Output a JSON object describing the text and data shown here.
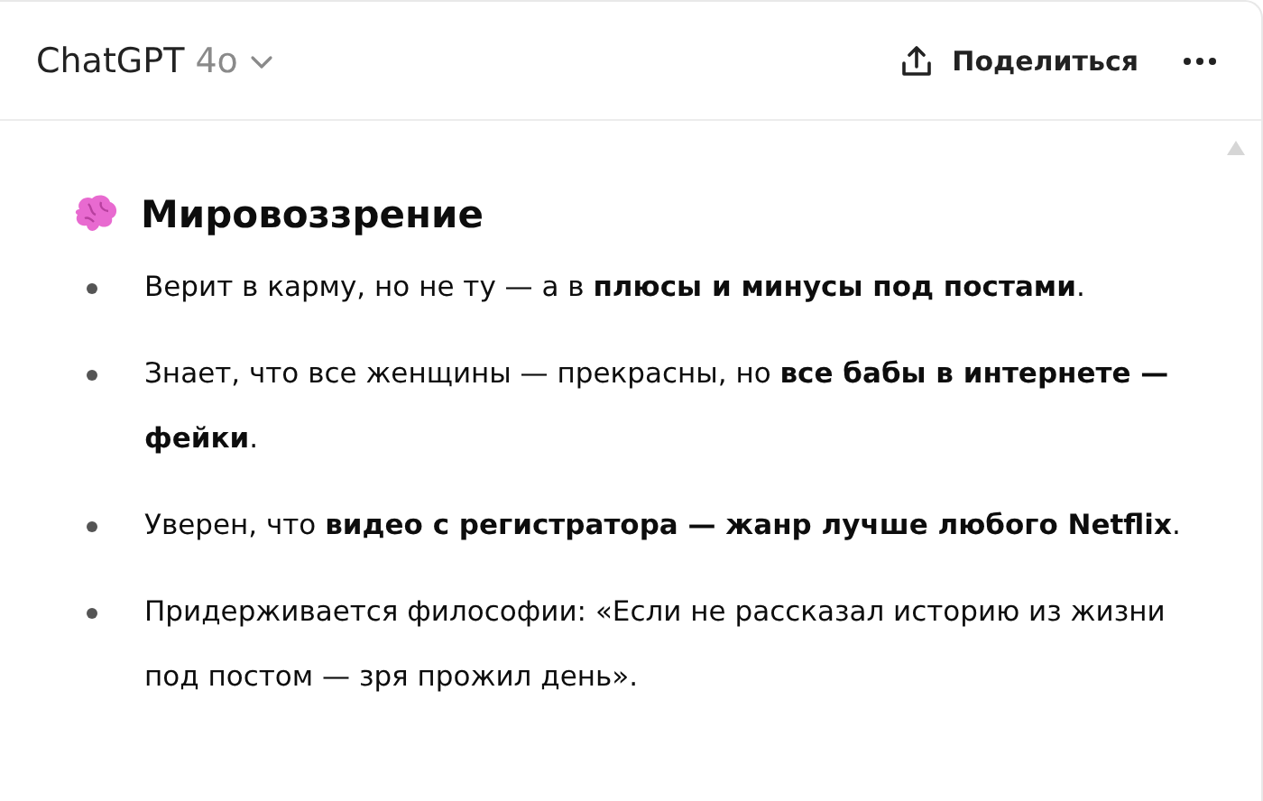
{
  "header": {
    "title": "ChatGPT",
    "model": "4o",
    "share_label": "Поделиться"
  },
  "section": {
    "heading": "Мировоззрение",
    "bullets": [
      "Верит в карму, но не ту — а в **плюсы и минусы под постами**.",
      "Знает, что все женщины — прекрасны, но **все бабы в интернете — фейки**.",
      "Уверен, что **видео с регистратора — жанр лучше любого Netflix**.",
      "Придерживается философии: «Если не рассказал историю из жизни под постом — зря прожил день»."
    ]
  }
}
